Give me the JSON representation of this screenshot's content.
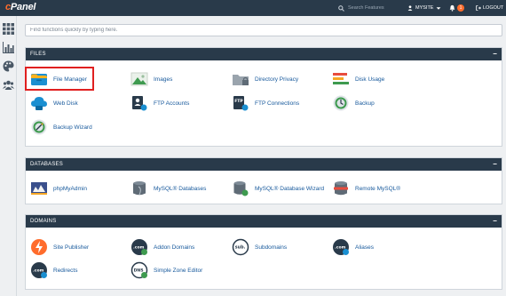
{
  "topbar": {
    "logo": "cPanel",
    "search_placeholder": "Search Features",
    "user_label": "MYSITE",
    "notification_count": "1",
    "logout_label": "LOGOUT"
  },
  "sidebar": {
    "items": [
      "apps-grid-icon",
      "stats-bar-icon",
      "palette-icon",
      "users-icon"
    ]
  },
  "quickfind": {
    "placeholder": "Find functions quickly by typing here."
  },
  "files": {
    "title": "FILES",
    "items": [
      "File Manager",
      "Images",
      "Directory Privacy",
      "Disk Usage",
      "Web Disk",
      "FTP Accounts",
      "FTP Connections",
      "Backup",
      "Backup Wizard"
    ]
  },
  "databases": {
    "title": "DATABASES",
    "items": [
      "phpMyAdmin",
      "MySQL® Databases",
      "MySQL® Database Wizard",
      "Remote MySQL®"
    ]
  },
  "domains": {
    "title": "DOMAINS",
    "items": [
      "Site Publisher",
      "Addon Domains",
      "Subdomains",
      "Aliases",
      "Redirects",
      "Simple Zone Editor"
    ],
    "icon_text": {
      "addon": ".com",
      "sub": "sub.",
      "aliases": ".com",
      "redirects": ".com",
      "zone": "DNS"
    }
  },
  "colors": {
    "header": "#293a4a",
    "accent": "#ff6c2c",
    "link": "#17599c",
    "highlight": "#e02020"
  }
}
